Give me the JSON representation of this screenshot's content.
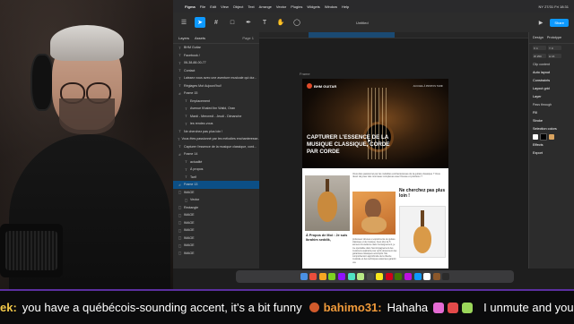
{
  "menubar": {
    "app": "Figma",
    "items": [
      "File",
      "Edit",
      "View",
      "Object",
      "Text",
      "Arrange",
      "Vector",
      "Plugins",
      "Widgets",
      "Window",
      "Help"
    ],
    "clock": "NY 27/31 Fri 18:31"
  },
  "toolbar": {
    "doc_title": "Untitled",
    "share_label": "Share"
  },
  "layers_panel": {
    "tabs": [
      "Layers",
      "Assets"
    ],
    "page": "Page 1",
    "items": [
      "BHM Guitar",
      "Facebook /",
      "06-38-88-00-77",
      "Contact",
      "Laissez vous avec une aventure musicale qui dur...",
      "Réglages Mot Aujourd'hui!",
      "Frame 15",
      "Emplacement",
      "Avenue Khaled Ibn Walid, Oran",
      "Mardi - Mercredi - Jeudi - Dimanche",
      "les rendez-vous",
      "Ne cherchez pas plus loin !",
      "Vous êtes passionné par les mélodies enchanteresse...",
      "Capturer l'essence de la musique classique, cord...",
      "Frame 14",
      "actualité",
      "À propos",
      "Tarif",
      "Frame 13",
      "IMAGE",
      "Vector",
      "Rectangle",
      "IMAGE",
      "IMAGE",
      "IMAGE",
      "IMAGE",
      "IMAGE",
      "IMAGE"
    ],
    "selected_index": 18
  },
  "canvas": {
    "frame_label": "Frame"
  },
  "site": {
    "brand": "BHM GUITAR",
    "nav": "ACCUEIL  À PROPOS  TARIF",
    "hero_title": "CAPTURER L'ESSENCE DE LA MUSIQUE CLASSIQUE, CORDE PAR CORDE",
    "intro": "Vous êtes passionné par les mélodies enchanteresses de la guitare classique ? Vous rêvez de jouer des morceaux complexes avec finesse et précision ?",
    "cta": "Ne cherchez pas plus loin !",
    "about_title": "À Propos de Moi : Je suis Ibrahim seddik,",
    "body": "professeur dévoué et expérimenté de guitare classique et de musique. Avec plus de 5 années d'excellence dans l'enseignement, je me spécialise dans l'accompagnement des musiciens aspirants pour qu'ils deviennent des guitaristes classiques accomplis. Ma compréhension approfondie de la théorie musicale et des techniques avancées garantit une"
  },
  "inspector": {
    "tabs": [
      "Design",
      "Prototype"
    ],
    "section_design": "Design",
    "x_label": "X",
    "y_label": "Y",
    "w_label": "W",
    "h_label": "H",
    "x_val": "4",
    "y_val": "0",
    "w_val": "250",
    "h_val": "16",
    "clip": "Clip content",
    "autolayout": "Auto layout",
    "constraints": "Constraints",
    "layout_grid": "Layout grid",
    "layer": "Layer",
    "pass_through": "Pass through",
    "fill": "Fill",
    "stroke": "Stroke",
    "selection_colors": "Selection colors",
    "effects": "Effects",
    "export": "Export"
  },
  "chat": [
    {
      "user": "ek:",
      "message": "you have a québécois-sounding accent, it's a bit funny"
    },
    {
      "user": "bahimo31:",
      "message": "Hahaha"
    },
    {
      "user": "",
      "message": "I unmute and you are speaking Fre"
    }
  ],
  "colors": {
    "accent": "#0d99ff",
    "chat_border": "#5b2fa0",
    "chat_user": "#f3c94a"
  }
}
